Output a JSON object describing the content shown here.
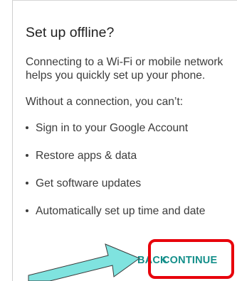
{
  "dialog": {
    "title": "Set up offline?",
    "intro": "Connecting to a Wi-Fi or mobile network helps you quickly set up your phone.",
    "lead": "Without a connection, you can’t:",
    "bullets": [
      "Sign in to your Google Account",
      "Restore apps & data",
      "Get software updates",
      "Automatically set up time and date"
    ],
    "actions": {
      "back_label": "BACK",
      "continue_label": "CONTINUE"
    }
  },
  "colors": {
    "accent": "#148f8a",
    "highlight": "#e8000b",
    "pointer_arrow": "#7fe3df"
  },
  "annotations": {
    "arrow_icon": "pointer-arrow-icon",
    "highlight": "continue-highlight-box"
  }
}
